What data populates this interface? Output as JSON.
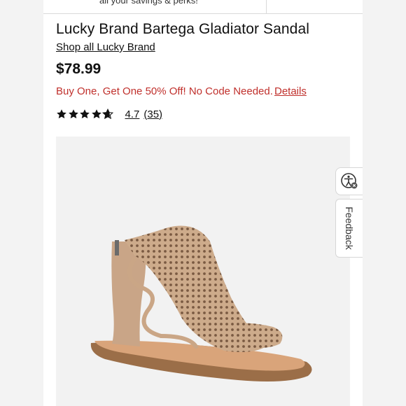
{
  "banner": {
    "text": "all your savings & perks!"
  },
  "product": {
    "title": "Lucky Brand Bartega Gladiator Sandal",
    "brand_link": "Shop all Lucky Brand",
    "price": "$78.99",
    "promo": "Buy One, Get One 50% Off! No Code Needed.",
    "promo_details": "Details",
    "rating_value": "4.7",
    "rating_count": "(35)",
    "rating": 4.7,
    "rating_max": 5
  },
  "widgets": {
    "feedback_label": "Feedback"
  },
  "colors": {
    "promo_red": "#c0302c",
    "image_bg": "#f2f2f2",
    "sandal": "#cfae8f"
  },
  "icons": [
    "star-icon",
    "accessibility-icon"
  ]
}
